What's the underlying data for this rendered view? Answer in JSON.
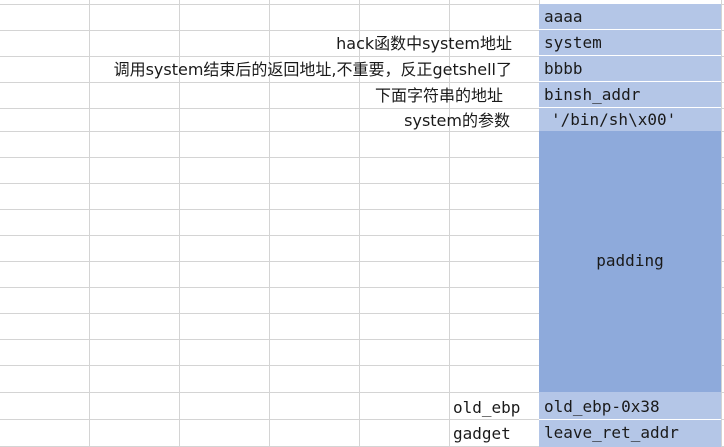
{
  "annotations": {
    "hack_system": "hack函数中system地址",
    "ret_after_system": "调用system结束后的返回地址,不重要，反正getshell了",
    "next_string_addr": "下面字符串的地址",
    "system_param": "system的参数",
    "old_ebp": "old_ebp",
    "gadget": "gadget"
  },
  "stack": {
    "aaaa": "aaaa",
    "system": "system",
    "bbbb": "bbbb",
    "binsh_addr": "binsh_addr",
    "binsh_str": "'/bin/sh\\x00'",
    "padding": "padding",
    "old_ebp_val": "old_ebp-0x38",
    "leave_ret": "leave_ret_addr"
  },
  "colors": {
    "stack_light": "#b4c6e7",
    "stack_dark": "#8eaadb",
    "gridline": "#d4d4d4"
  }
}
